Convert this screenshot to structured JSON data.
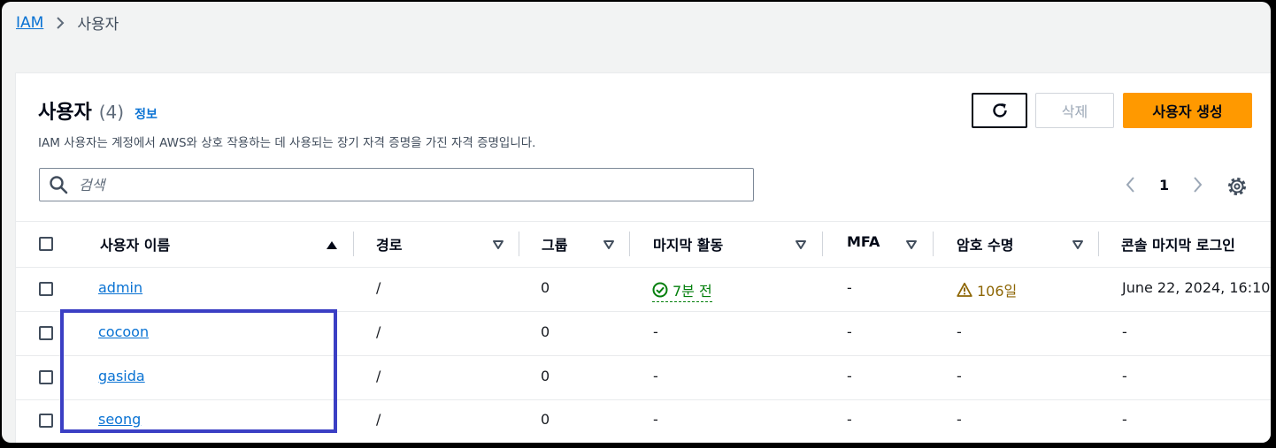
{
  "breadcrumb": {
    "root": "IAM",
    "current": "사용자"
  },
  "header": {
    "title": "사용자",
    "count": "(4)",
    "info": "정보",
    "description": "IAM 사용자는 계정에서 AWS와 상호 작용하는 데 사용되는 장기 자격 증명을 가진 자격 증명입니다."
  },
  "actions": {
    "refresh_icon": "refresh-icon",
    "delete": "삭제",
    "create": "사용자 생성"
  },
  "search": {
    "placeholder": "검색",
    "value": ""
  },
  "pagination": {
    "page": "1"
  },
  "columns": [
    "사용자 이름",
    "경로",
    "그룹",
    "마지막 활동",
    "MFA",
    "암호 수명",
    "콘솔 마지막 로그인"
  ],
  "rows": [
    {
      "name": "admin",
      "path": "/",
      "groups": "0",
      "activity": "7분 전",
      "mfa": "-",
      "password_age": "106일",
      "console_login": "June 22, 2024, 16:10"
    },
    {
      "name": "cocoon",
      "path": "/",
      "groups": "0",
      "activity": "-",
      "mfa": "-",
      "password_age": "-",
      "console_login": "-"
    },
    {
      "name": "gasida",
      "path": "/",
      "groups": "0",
      "activity": "-",
      "mfa": "-",
      "password_age": "-",
      "console_login": "-"
    },
    {
      "name": "seong",
      "path": "/",
      "groups": "0",
      "activity": "-",
      "mfa": "-",
      "password_age": "-",
      "console_login": "-"
    }
  ],
  "colors": {
    "link": "#0972d3",
    "primary": "#ff9900",
    "success": "#037f0c",
    "warning": "#8d6605",
    "highlight": "#3b3fc4"
  }
}
